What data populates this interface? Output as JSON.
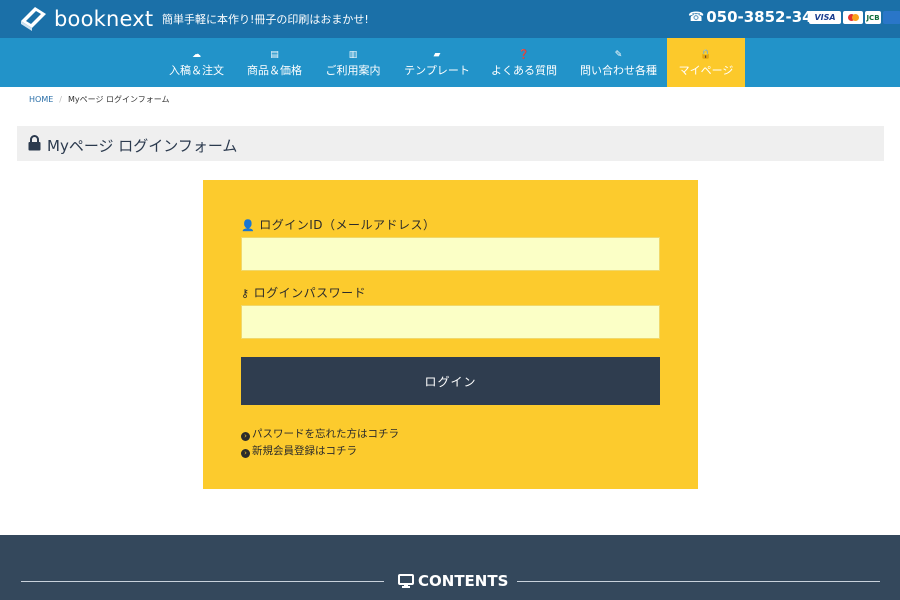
{
  "header": {
    "logo_text": "booknext",
    "tagline": "簡単手軽に本作り!冊子の印刷はおまかせ!",
    "phone_icon": "☎",
    "phone": "050-3852-3490",
    "cards": {
      "visa": "VISA",
      "jcb": "JCB"
    }
  },
  "nav": {
    "items": [
      {
        "icon": "cloud-upload-icon",
        "glyph": "☁",
        "label": "入稿＆注文"
      },
      {
        "icon": "book-price-icon",
        "glyph": "▤",
        "label": "商品＆価格"
      },
      {
        "icon": "guide-icon",
        "glyph": "▥",
        "label": "ご利用案内"
      },
      {
        "icon": "template-book-icon",
        "glyph": "▰",
        "label": "テンプレート"
      },
      {
        "icon": "question-circle-icon",
        "glyph": "❓",
        "label": "よくある質問"
      },
      {
        "icon": "edit-icon",
        "glyph": "✎",
        "label": "問い合わせ各種"
      },
      {
        "icon": "lock-icon",
        "glyph": "🔒",
        "label": "マイページ"
      }
    ]
  },
  "breadcrumb": {
    "home": "HOME",
    "separator": "/",
    "current": "Myページ ログインフォーム"
  },
  "page_title": "Myページ ログインフォーム",
  "login": {
    "id_label": "ログインID（メールアドレス）",
    "id_icon": "user-icon",
    "id_value": "",
    "password_label": "ログインパスワード",
    "password_icon": "key-icon",
    "password_value": "",
    "button_label": "ログイン",
    "links": {
      "forgot": "パスワードを忘れた方はコチラ",
      "register": "新規会員登録はコチラ"
    }
  },
  "footer": {
    "title": "CONTENTS"
  },
  "colors": {
    "topbar": "#1b70a8",
    "nav": "#2293c9",
    "accent_yellow": "#fccb2d",
    "input_bg": "#fbffc6",
    "button_dark": "#2f3d4f",
    "footer": "#34485c"
  }
}
